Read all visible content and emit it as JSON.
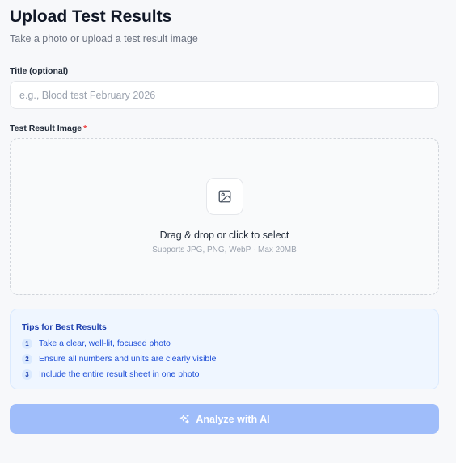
{
  "header": {
    "title": "Upload Test Results",
    "subtitle": "Take a photo or upload a test result image"
  },
  "form": {
    "title_field": {
      "label": "Title (optional)",
      "value": "",
      "placeholder": "e.g., Blood test February 2026"
    },
    "image_field": {
      "label": "Test Result Image",
      "required_marker": "*"
    },
    "dropzone": {
      "icon": "image-icon",
      "title": "Drag & drop or click to select",
      "hint": "Supports JPG, PNG, WebP · Max 20MB"
    }
  },
  "tips": {
    "title": "Tips for Best Results",
    "items": [
      {
        "number": "1",
        "text": "Take a clear, well-lit, focused photo"
      },
      {
        "number": "2",
        "text": "Ensure all numbers and units are clearly visible"
      },
      {
        "number": "3",
        "text": "Include the entire result sheet in one photo"
      }
    ]
  },
  "actions": {
    "analyze_label": "Analyze with AI",
    "analyze_icon": "sparkles-icon",
    "analyze_disabled": true
  },
  "colors": {
    "accent": "#2563eb",
    "button_disabled": "#9fbdfa",
    "tips_background": "#eff6ff",
    "tips_text": "#1d4ed8",
    "required": "#ef4444"
  }
}
